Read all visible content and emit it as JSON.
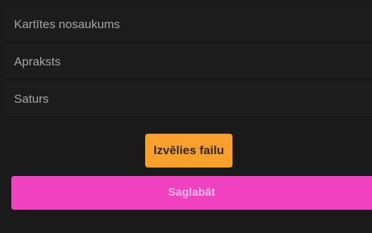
{
  "form": {
    "title_placeholder": "Kartītes nosaukums",
    "description_placeholder": "Apraksts",
    "content_placeholder": "Saturs",
    "choose_file_label": "Izvēlies failu",
    "save_label": "Saglabāt"
  },
  "colors": {
    "background": "#1a1a1a",
    "choose_file_button": "#f9a02c",
    "save_button": "#f041c0"
  }
}
